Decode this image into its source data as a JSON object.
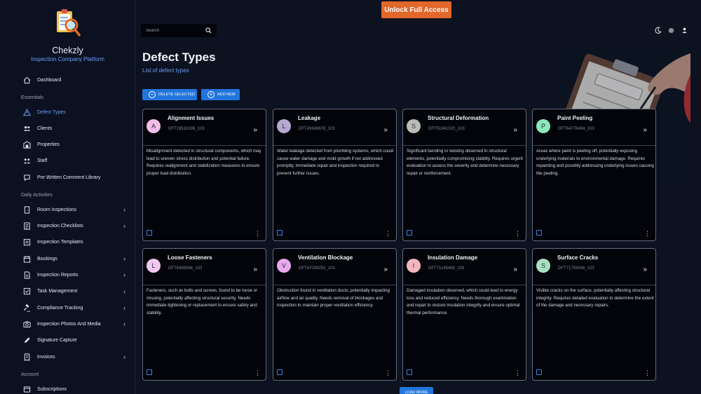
{
  "brand": {
    "name": "Chekzly",
    "subtitle": "Inspection Company Platform"
  },
  "colors": {
    "accent": "#6d9df5",
    "primary_button": "#2175dd",
    "unlock": "#e1672a"
  },
  "topbar": {
    "unlock_label": "Unlock Full Access",
    "search_placeholder": "Search",
    "icons": [
      "moon-icon",
      "gear-icon",
      "user-icon"
    ]
  },
  "sidebar": {
    "dashboard": "Dashboard",
    "sections": {
      "essentials": "Essentials",
      "daily": "Daily Activities",
      "account": "Account"
    },
    "essentials": [
      {
        "label": "Defect Types",
        "icon": "warning-triangle-icon",
        "active": true
      },
      {
        "label": "Clients",
        "icon": "users-icon"
      },
      {
        "label": "Properties",
        "icon": "building-icon"
      },
      {
        "label": "Staff",
        "icon": "staff-icon"
      },
      {
        "label": "Pre Written Comment Library",
        "icon": "comment-icon"
      }
    ],
    "daily": [
      {
        "label": "Room Inspections",
        "icon": "door-icon",
        "has_sub": true
      },
      {
        "label": "Inspection Checklists",
        "icon": "checklist-icon",
        "has_sub": true
      },
      {
        "label": "Inspection Templates",
        "icon": "template-icon",
        "has_sub": false
      },
      {
        "label": "Bookings",
        "icon": "calendar-icon",
        "has_sub": true
      },
      {
        "label": "Inspection Reports",
        "icon": "report-icon",
        "has_sub": true
      },
      {
        "label": "Task Management",
        "icon": "task-icon",
        "has_sub": true
      },
      {
        "label": "Compliance Tracking",
        "icon": "gavel-icon",
        "has_sub": true
      },
      {
        "label": "Inspection Photos And Media",
        "icon": "camera-icon",
        "has_sub": true
      },
      {
        "label": "Signature Capture",
        "icon": "pen-icon",
        "has_sub": false
      },
      {
        "label": "Invoices",
        "icon": "invoice-icon",
        "has_sub": true
      }
    ],
    "account": [
      {
        "label": "Subscriptions",
        "icon": "subscription-icon"
      }
    ]
  },
  "page": {
    "title": "Defect Types",
    "subtitle": "List of defect types",
    "delete_label": "DELETE SELECTED",
    "add_label": "ADD NEW",
    "load_more_label": "LOAD MORE"
  },
  "cards": [
    {
      "initial": "A",
      "title": "Alignment Issues",
      "code": "DFT19516198_103",
      "color": "#f2bde6",
      "desc": "Misalignment detected in structural components, which may lead to uneven stress distribution and potential failure. Requires realignment and stabilization measures to ensure proper load distribution."
    },
    {
      "initial": "L",
      "title": "Leakage",
      "code": "DFT49349878_103",
      "color": "#b7a9d3",
      "desc": "Water leakage detected from plumbing systems, which could cause water damage and mold growth if not addressed promptly. Immediate repair and inspection required to prevent further issues."
    },
    {
      "initial": "S",
      "title": "Structural Deformation",
      "code": "DFT51941020_103",
      "color": "#b9bcb7",
      "desc": "Significant bending or twisting observed in structural elements, potentially compromising stability. Requires urgent evaluation to assess the severity and determine necessary repair or reinforcement."
    },
    {
      "initial": "P",
      "title": "Paint Peeling",
      "code": "DFT64778494_103",
      "color": "#8be8b9",
      "desc": "Areas where paint is peeling off, potentially exposing underlying materials to environmental damage. Requires repainting and possibly addressing underlying issues causing the peeling."
    },
    {
      "initial": "L",
      "title": "Loose Fasteners",
      "code": "DFT6495596_103",
      "color": "#f3c8f1",
      "desc": "Fasteners, such as bolts and screws, found to be loose or missing, potentially affecting structural security. Needs immediate tightening or replacement to ensure safety and stability."
    },
    {
      "initial": "V",
      "title": "Ventilation Blockage",
      "code": "DFT67039292_103",
      "color": "#e9a9ee",
      "desc": "Obstruction found in ventilation ducts, potentially impacting airflow and air quality. Needs removal of blockages and inspection to maintain proper ventilation efficiency."
    },
    {
      "initial": "I",
      "title": "Insulation Damage",
      "code": "DFT71145469_103",
      "color": "#f4b7bf",
      "desc": "Damaged insulation observed, which could lead to energy loss and reduced efficiency. Needs thorough examination and repair to restore insulation integrity and ensure optimal thermal performance."
    },
    {
      "initial": "S",
      "title": "Surface Cracks",
      "code": "DFT71759936_103",
      "color": "#a8e1c0",
      "desc": "Visible cracks on the surface, potentially affecting structural integrity. Requires detailed evaluation to determine the extent of the damage and necessary repairs."
    }
  ]
}
